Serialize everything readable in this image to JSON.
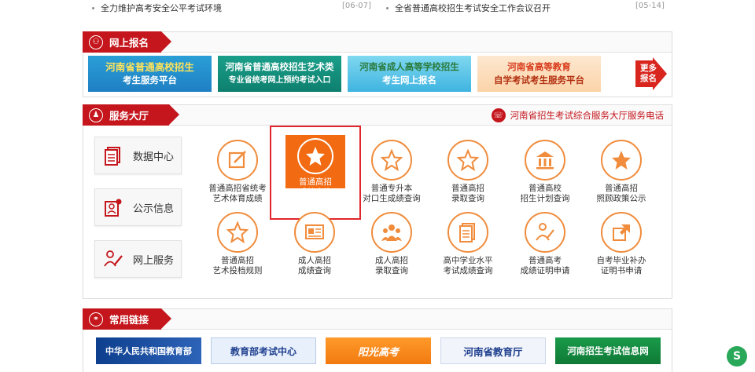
{
  "news": [
    {
      "title": "全力维护高考安全公平考试环境",
      "date": "[06-07]"
    },
    {
      "title": "全省普通高校招生考试安全工作会议召开",
      "date": "[05-14]"
    }
  ],
  "online": {
    "title": "网上报名",
    "banners": [
      {
        "line1": "河南省普通高校招生",
        "line2": "考生服务平台"
      },
      {
        "line1": "河南省普通高校招生艺术类",
        "line2": "专业省统考网上预约考试入口"
      },
      {
        "line1": "河南省成人高等学校招生",
        "line2": "考生网上报名"
      },
      {
        "line1": "河南省高等教育",
        "line2": "自学考试考生服务平台"
      }
    ],
    "more": {
      "line1": "更多",
      "line2": "报名"
    }
  },
  "service": {
    "title": "服务大厅",
    "hotline": "河南省招生考试综合服务大厅服务电话",
    "side": [
      {
        "label": "数据中心"
      },
      {
        "label": "公示信息"
      },
      {
        "label": "网上服务"
      }
    ],
    "items": [
      {
        "line1": "普通高招省统考",
        "line2": "艺术体育成绩",
        "icon": "edit-icon"
      },
      {
        "line1": "普通高招",
        "line2": "成绩查询",
        "icon": "star-icon"
      },
      {
        "line1": "普通专升本",
        "line2": "对口生成绩查询",
        "icon": "star-icon"
      },
      {
        "line1": "普通高招",
        "line2": "录取查询",
        "icon": "star-icon"
      },
      {
        "line1": "普通高校",
        "line2": "招生计划查询",
        "icon": "building-icon"
      },
      {
        "line1": "普通高招",
        "line2": "照顾政策公示",
        "icon": "star-icon"
      },
      {
        "line1": "普通高招",
        "line2": "艺术投档规则",
        "icon": "star-icon"
      },
      {
        "line1": "成人高招",
        "line2": "成绩查询",
        "icon": "certificate-icon"
      },
      {
        "line1": "成人高招",
        "line2": "录取查询",
        "icon": "people-icon"
      },
      {
        "line1": "高中学业水平",
        "line2": "考试成绩查询",
        "icon": "document-icon"
      },
      {
        "line1": "普通高考",
        "line2": "成绩证明申请",
        "icon": "person-icon"
      },
      {
        "line1": "自考毕业补办",
        "line2": "证明书申请",
        "icon": "share-icon"
      }
    ]
  },
  "links": {
    "title": "常用链接",
    "items": [
      {
        "label": "中华人民共和国教育部"
      },
      {
        "label": "教育部考试中心"
      },
      {
        "label": "阳光高考"
      },
      {
        "label": "河南省教育厅"
      },
      {
        "label": "河南招生考试信息网"
      }
    ]
  },
  "colors": {
    "brand": "#c4161c",
    "accent": "#f26a12",
    "icon": "#f08c3c"
  }
}
